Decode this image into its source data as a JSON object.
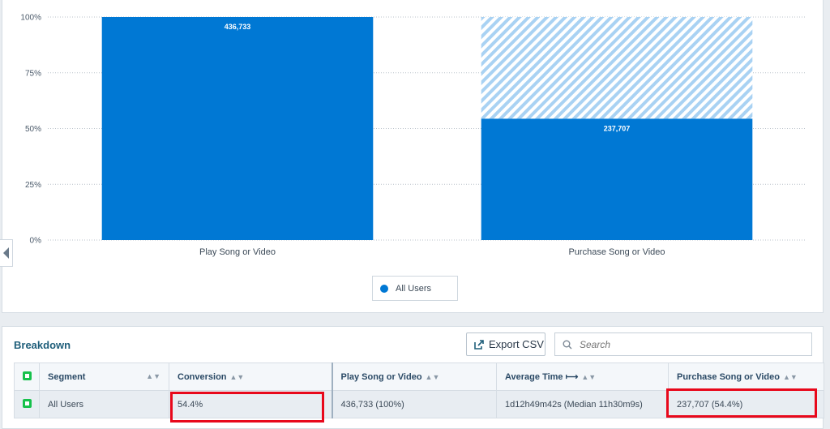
{
  "chart_data": {
    "type": "bar",
    "categories": [
      "Play Song or Video",
      "Purchase Song or Video"
    ],
    "series": [
      {
        "name": "All Users",
        "values": [
          100,
          54.4
        ],
        "labels": [
          "436,733",
          "237,707"
        ]
      }
    ],
    "y_ticks": [
      "100%",
      "75%",
      "50%",
      "25%",
      "0%"
    ],
    "ylim": [
      0,
      100
    ],
    "grid": true,
    "legend_position": "bottom-center",
    "colors": {
      "bar": "#0078d4",
      "dropoff_hatch": "#a9d2f3",
      "dropoff_background": "#ffffff"
    }
  },
  "legend": {
    "label": "All Users",
    "color": "#0078d4"
  },
  "breakdown": {
    "title": "Breakdown",
    "export_label": "Export CSV",
    "search_placeholder": "Search",
    "columns": [
      "Segment",
      "Conversion",
      "Play Song or Video",
      "Average Time",
      "Purchase Song or Video"
    ],
    "avg_time_arrow": "⟼",
    "rows": [
      {
        "segment": "All Users",
        "conversion": "54.4%",
        "play": "436,733 (100%)",
        "avg_time": "1d12h49m42s (Median 11h30m9s)",
        "purchase": "237,707 (54.4%)"
      }
    ],
    "highlight_color": "#e8081b"
  },
  "icons": {
    "export": "export-icon",
    "search": "search-icon",
    "collapse": "chevron-left-icon",
    "sort": "sort-icon",
    "segment_toggle": "checkbox-icon"
  }
}
